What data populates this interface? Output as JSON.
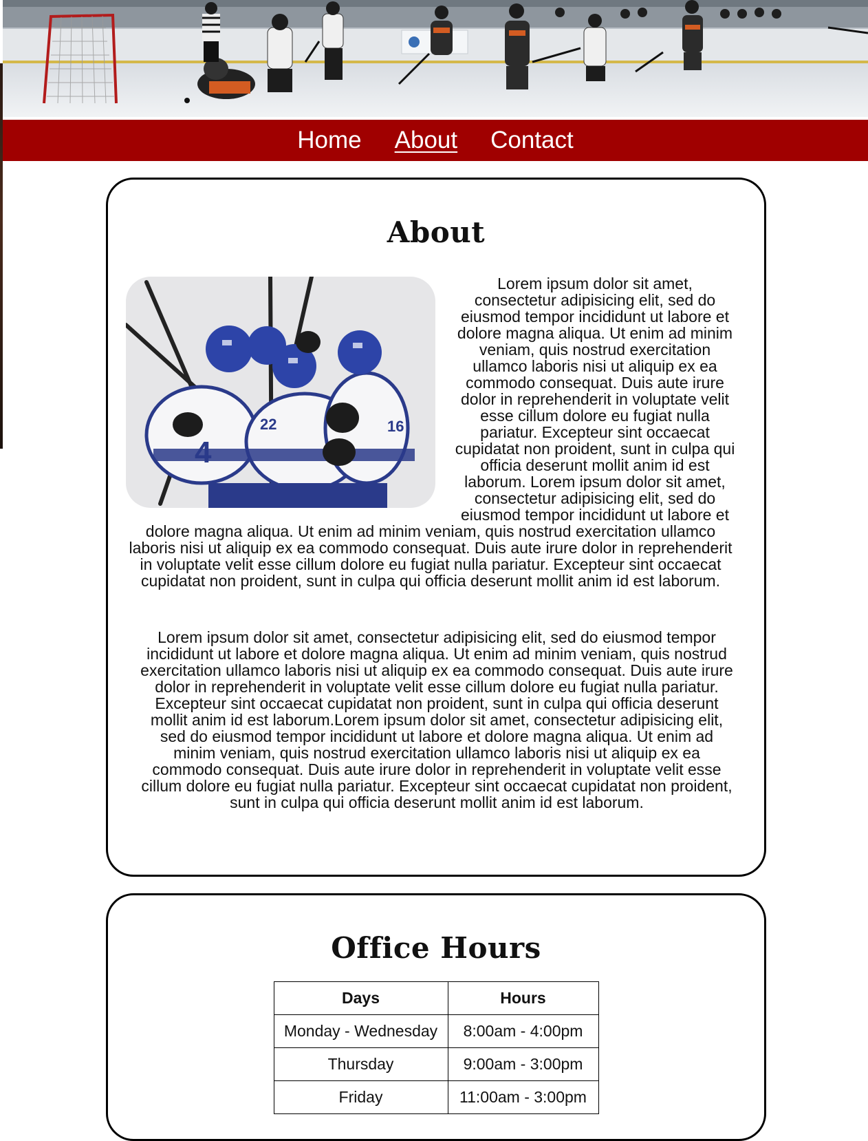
{
  "header": {
    "banner_image": "hockey-game-banner"
  },
  "nav": {
    "items": [
      {
        "label": "Home"
      },
      {
        "label": "About"
      },
      {
        "label": "Contact"
      }
    ],
    "active": "About"
  },
  "about": {
    "title": "About",
    "image": "hockey-team-celebration-photo",
    "paragraph_1": "Lorem ipsum dolor sit amet, consectetur adipisicing elit, sed do eiusmod tempor incididunt ut labore et dolore magna aliqua. Ut enim ad minim veniam, quis nostrud exercitation ullamco laboris nisi ut aliquip ex ea commodo consequat. Duis aute irure dolor in reprehenderit in voluptate velit esse cillum dolore eu fugiat nulla pariatur. Excepteur sint occaecat cupidatat non proident, sunt in culpa qui officia deserunt mollit anim id est laborum. Lorem ipsum dolor sit amet, consectetur adipisicing elit, sed do eiusmod tempor incididunt ut labore et dolore magna aliqua. Ut enim ad minim veniam, quis nostrud exercitation ullamco laboris nisi ut aliquip ex ea commodo consequat. Duis aute irure dolor in reprehenderit in voluptate velit esse cillum dolore eu fugiat nulla pariatur. Excepteur sint occaecat cupidatat non proident, sunt in culpa qui officia deserunt mollit anim id est laborum.",
    "paragraph_2": "Lorem ipsum dolor sit amet, consectetur adipisicing elit, sed do eiusmod tempor incididunt ut labore et dolore magna aliqua. Ut enim ad minim veniam, quis nostrud exercitation ullamco laboris nisi ut aliquip ex ea commodo consequat. Duis aute irure dolor in reprehenderit in voluptate velit esse cillum dolore eu fugiat nulla pariatur. Excepteur sint occaecat cupidatat non proident, sunt in culpa qui officia deserunt mollit anim id est laborum.Lorem ipsum dolor sit amet, consectetur adipisicing elit, sed do eiusmod tempor incididunt ut labore et dolore magna aliqua. Ut enim ad minim veniam, quis nostrud exercitation ullamco laboris nisi ut aliquip ex ea commodo consequat. Duis aute irure dolor in reprehenderit in voluptate velit esse cillum dolore eu fugiat nulla pariatur. Excepteur sint occaecat cupidatat non proident, sunt in culpa qui officia deserunt mollit anim id est laborum."
  },
  "office_hours": {
    "title": "Office Hours",
    "headers": {
      "days": "Days",
      "hours": "Hours"
    },
    "rows": [
      {
        "days": "Monday - Wednesday",
        "hours": "8:00am - 4:00pm"
      },
      {
        "days": "Thursday",
        "hours": "9:00am - 3:00pm"
      },
      {
        "days": "Friday",
        "hours": "11:00am - 3:00pm"
      }
    ]
  },
  "colors": {
    "nav_background": "#a00000",
    "nav_text": "#ffffff",
    "card_border": "#000000"
  }
}
